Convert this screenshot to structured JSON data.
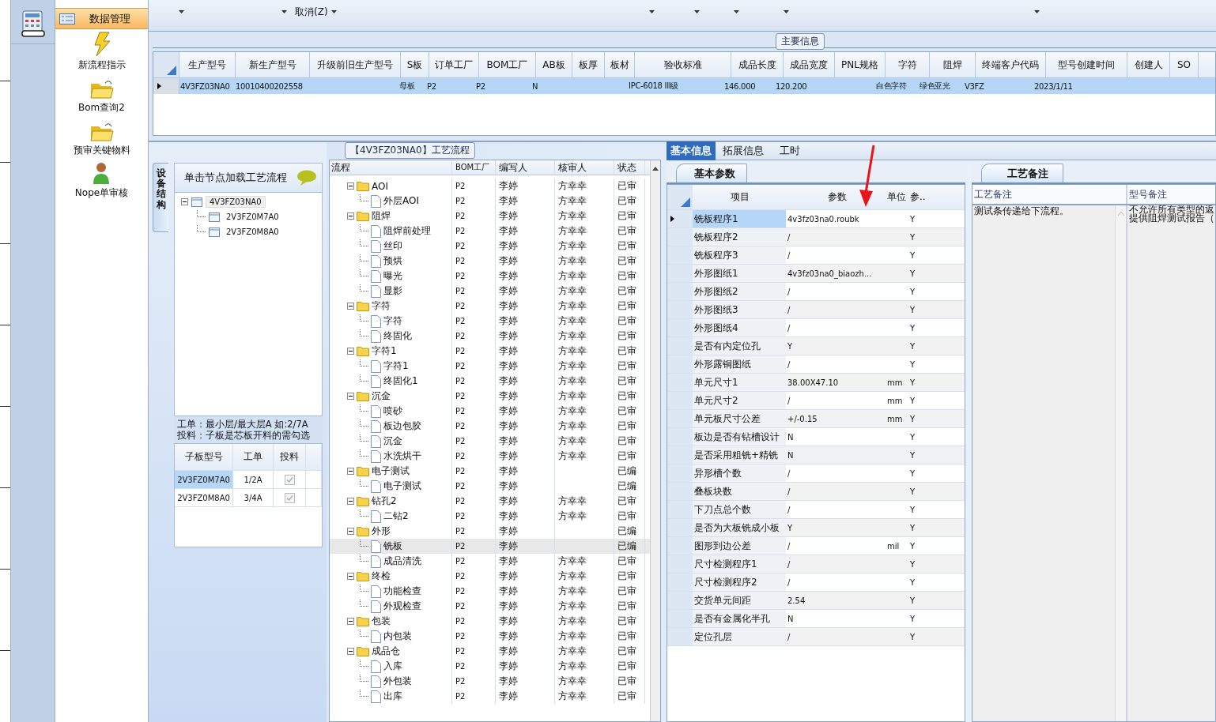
{
  "toolbar": {
    "menu_items": [
      "取消(Z)"
    ]
  },
  "nav": {
    "header": {
      "label": "数据管理",
      "selected": true
    },
    "items": [
      {
        "label": "新流程指示",
        "kind": "lightning"
      },
      {
        "label": "Bom查询2",
        "kind": "folder"
      },
      {
        "label": "预审关键物料",
        "kind": "folder"
      },
      {
        "label": "Nope单审核",
        "kind": "person"
      }
    ]
  },
  "main_info": {
    "title": "主要信息",
    "columns": [
      "生产型号",
      "新生产型号",
      "升级前旧生产型号",
      "S板",
      "订单工厂",
      "BOM工厂",
      "AB板",
      "板厚",
      "板材",
      "验收标准",
      "成品长度",
      "成品宽度",
      "PNL规格",
      "字符",
      "阻焊",
      "终端客户代码",
      "型号创建时间",
      "创建人",
      "SO"
    ],
    "rows": [
      {
        "selected": true,
        "cells": [
          "4V3FZ03NA0",
          "10010400202558",
          "",
          "母板",
          "P2",
          "P2",
          "N",
          "",
          "",
          "IPC-6018 III级",
          "146.000",
          "120.200",
          "",
          "白色字符",
          "绿色亚光",
          "V3FZ",
          "2023/1/11",
          "",
          ""
        ]
      }
    ]
  },
  "structure": {
    "tab_label": "设备结构",
    "hint": "单击节点加载工艺流程",
    "tree": [
      {
        "label": "4V3FZ03NA0",
        "selected": true,
        "expanded": true,
        "children": [
          {
            "label": "2V3FZ0M7A0",
            "selected": false
          },
          {
            "label": "2V3FZ0M8A0",
            "selected": false
          }
        ]
      }
    ],
    "note_lines": [
      "工单：最小层/最大层A 如:2/7A",
      "投料：子板是芯板开料的需勾选"
    ],
    "sub_table": {
      "columns": [
        "子板型号",
        "工单",
        "投料"
      ],
      "rows": [
        {
          "model": "2V3FZ0M7A0",
          "order": "1/2A",
          "feed": true,
          "selected": true
        },
        {
          "model": "2V3FZ0M8A0",
          "order": "3/4A",
          "feed": true,
          "selected": false
        }
      ]
    }
  },
  "flow": {
    "title": "【4V3FZ03NA0】工艺流程",
    "columns": [
      "流程",
      "BOM工厂",
      "编写人",
      "核审人",
      "状态"
    ],
    "tree": [
      {
        "label": "AOI",
        "bom": "P2",
        "writer": "李婷",
        "reviewer": "方幸幸",
        "status": "已审",
        "expanded": true,
        "selected": false,
        "children": [
          {
            "label": "外层AOI",
            "bom": "P2",
            "writer": "李婷",
            "reviewer": "方幸幸",
            "status": "已审",
            "selected": false
          }
        ]
      },
      {
        "label": "阻焊",
        "bom": "P2",
        "writer": "李婷",
        "reviewer": "方幸幸",
        "status": "已审",
        "expanded": true,
        "selected": false,
        "children": [
          {
            "label": "阻焊前处理",
            "bom": "P2",
            "writer": "李婷",
            "reviewer": "方幸幸",
            "status": "已审",
            "selected": false
          },
          {
            "label": "丝印",
            "bom": "P2",
            "writer": "李婷",
            "reviewer": "方幸幸",
            "status": "已审",
            "selected": false
          },
          {
            "label": "预烘",
            "bom": "P2",
            "writer": "李婷",
            "reviewer": "方幸幸",
            "status": "已审",
            "selected": false
          },
          {
            "label": "曝光",
            "bom": "P2",
            "writer": "李婷",
            "reviewer": "方幸幸",
            "status": "已审",
            "selected": false
          },
          {
            "label": "显影",
            "bom": "P2",
            "writer": "李婷",
            "reviewer": "方幸幸",
            "status": "已审",
            "selected": false
          }
        ]
      },
      {
        "label": "字符",
        "bom": "P2",
        "writer": "李婷",
        "reviewer": "方幸幸",
        "status": "已审",
        "expanded": true,
        "selected": false,
        "children": [
          {
            "label": "字符",
            "bom": "P2",
            "writer": "李婷",
            "reviewer": "方幸幸",
            "status": "已审",
            "selected": false
          },
          {
            "label": "终固化",
            "bom": "P2",
            "writer": "李婷",
            "reviewer": "方幸幸",
            "status": "已审",
            "selected": false
          }
        ]
      },
      {
        "label": "字符1",
        "bom": "P2",
        "writer": "李婷",
        "reviewer": "方幸幸",
        "status": "已审",
        "expanded": true,
        "selected": false,
        "children": [
          {
            "label": "字符1",
            "bom": "P2",
            "writer": "李婷",
            "reviewer": "方幸幸",
            "status": "已审",
            "selected": false
          },
          {
            "label": "终固化1",
            "bom": "P2",
            "writer": "李婷",
            "reviewer": "方幸幸",
            "status": "已审",
            "selected": false
          }
        ]
      },
      {
        "label": "沉金",
        "bom": "P2",
        "writer": "李婷",
        "reviewer": "方幸幸",
        "status": "已审",
        "expanded": true,
        "selected": false,
        "children": [
          {
            "label": "喷砂",
            "bom": "P2",
            "writer": "李婷",
            "reviewer": "方幸幸",
            "status": "已审",
            "selected": false
          },
          {
            "label": "板边包胶",
            "bom": "P2",
            "writer": "李婷",
            "reviewer": "方幸幸",
            "status": "已审",
            "selected": false
          },
          {
            "label": "沉金",
            "bom": "P2",
            "writer": "李婷",
            "reviewer": "方幸幸",
            "status": "已审",
            "selected": false
          },
          {
            "label": "水洗烘干",
            "bom": "P2",
            "writer": "李婷",
            "reviewer": "方幸幸",
            "status": "已审",
            "selected": false
          }
        ]
      },
      {
        "label": "电子测试",
        "bom": "P2",
        "writer": "李婷",
        "status": "已编",
        "expanded": true,
        "selected": false,
        "children": [
          {
            "label": "电子测试",
            "bom": "P2",
            "writer": "李婷",
            "status": "已编",
            "selected": false
          }
        ]
      },
      {
        "label": "钻孔2",
        "bom": "P2",
        "writer": "李婷",
        "reviewer": "方幸幸",
        "status": "已审",
        "expanded": true,
        "selected": false,
        "children": [
          {
            "label": "二钻2",
            "bom": "P2",
            "writer": "李婷",
            "reviewer": "方幸幸",
            "status": "已审",
            "selected": false
          }
        ]
      },
      {
        "label": "外形",
        "bom": "P2",
        "writer": "李婷",
        "status": "已编",
        "expanded": true,
        "selected": false,
        "children": [
          {
            "label": "铣板",
            "bom": "P2",
            "writer": "李婷",
            "status": "已编",
            "selected": true
          },
          {
            "label": "成品清洗",
            "bom": "P2",
            "writer": "李婷",
            "reviewer": "方幸幸",
            "status": "已审",
            "selected": false
          }
        ]
      },
      {
        "label": "终检",
        "bom": "P2",
        "writer": "李婷",
        "reviewer": "方幸幸",
        "status": "已审",
        "expanded": true,
        "selected": false,
        "children": [
          {
            "label": "功能检查",
            "bom": "P2",
            "writer": "李婷",
            "reviewer": "方幸幸",
            "status": "已审",
            "selected": false
          },
          {
            "label": "外观检查",
            "bom": "P2",
            "writer": "李婷",
            "reviewer": "方幸幸",
            "status": "已审",
            "selected": false
          }
        ]
      },
      {
        "label": "包装",
        "bom": "P2",
        "writer": "李婷",
        "reviewer": "方幸幸",
        "status": "已审",
        "expanded": true,
        "selected": false,
        "children": [
          {
            "label": "内包装",
            "bom": "P2",
            "writer": "李婷",
            "reviewer": "方幸幸",
            "status": "已审",
            "selected": false
          }
        ]
      },
      {
        "label": "成品仓",
        "bom": "P2",
        "writer": "李婷",
        "reviewer": "方幸幸",
        "status": "已审",
        "expanded": true,
        "selected": false,
        "children": [
          {
            "label": "入库",
            "bom": "P2",
            "writer": "李婷",
            "reviewer": "方幸幸",
            "status": "已审",
            "selected": false
          },
          {
            "label": "外包装",
            "bom": "P2",
            "writer": "李婷",
            "reviewer": "方幸幸",
            "status": "已审",
            "selected": false
          },
          {
            "label": "出库",
            "bom": "P2",
            "writer": "李婷",
            "reviewer": "方幸幸",
            "status": "已审",
            "selected": false
          }
        ]
      }
    ]
  },
  "detail_tabs": [
    {
      "label": "基本信息",
      "selected": true
    },
    {
      "label": "拓展信息",
      "selected": false
    },
    {
      "label": "工时",
      "selected": false
    }
  ],
  "params": {
    "tab": "基本参数",
    "columns": [
      "项目",
      "参数",
      "单位",
      "参.."
    ],
    "rows": [
      {
        "item": "铣板程序1",
        "value": "4v3fz03na0.roubk",
        "unit": "",
        "flag": "Y",
        "selected": true
      },
      {
        "item": "铣板程序2",
        "value": "/",
        "unit": "",
        "flag": "Y",
        "selected": false
      },
      {
        "item": "铣板程序3",
        "value": "/",
        "unit": "",
        "flag": "Y",
        "selected": false
      },
      {
        "item": "外形图纸1",
        "value": "4v3fz03na0_biaozh...",
        "unit": "",
        "flag": "Y",
        "selected": false
      },
      {
        "item": "外形图纸2",
        "value": "/",
        "unit": "",
        "flag": "Y",
        "selected": false
      },
      {
        "item": "外形图纸3",
        "value": "/",
        "unit": "",
        "flag": "Y",
        "selected": false
      },
      {
        "item": "外形图纸4",
        "value": "/",
        "unit": "",
        "flag": "Y",
        "selected": false
      },
      {
        "item": "是否有内定位孔",
        "value": "Y",
        "unit": "",
        "flag": "Y",
        "selected": false
      },
      {
        "item": "外形露铜图纸",
        "value": "/",
        "unit": "",
        "flag": "Y",
        "selected": false
      },
      {
        "item": "单元尺寸1",
        "value": "38.00X47.10",
        "unit": "mm",
        "flag": "Y",
        "selected": false
      },
      {
        "item": "单元尺寸2",
        "value": "/",
        "unit": "mm",
        "flag": "Y",
        "selected": false
      },
      {
        "item": "单元板尺寸公差",
        "value": "+/-0.15",
        "unit": "mm",
        "flag": "Y",
        "selected": false
      },
      {
        "item": "板边是否有钻槽设计",
        "value": "N",
        "unit": "",
        "flag": "Y",
        "selected": false
      },
      {
        "item": "是否采用粗铣+精铣",
        "value": "N",
        "unit": "",
        "flag": "Y",
        "selected": false
      },
      {
        "item": "异形槽个数",
        "value": "/",
        "unit": "",
        "flag": "Y",
        "selected": false
      },
      {
        "item": "叠板块数",
        "value": "/",
        "unit": "",
        "flag": "Y",
        "selected": false
      },
      {
        "item": "下刀点总个数",
        "value": "/",
        "unit": "",
        "flag": "Y",
        "selected": false
      },
      {
        "item": "是否为大板铣成小板",
        "value": "Y",
        "unit": "",
        "flag": "Y",
        "selected": false
      },
      {
        "item": "图形到边公差",
        "value": "/",
        "unit": "mil",
        "flag": "Y",
        "selected": false
      },
      {
        "item": "尺寸检测程序1",
        "value": "/",
        "unit": "",
        "flag": "Y",
        "selected": false
      },
      {
        "item": "尺寸检测程序2",
        "value": "/",
        "unit": "",
        "flag": "Y",
        "selected": false
      },
      {
        "item": "交货单元间距",
        "value": "2.54",
        "unit": "",
        "flag": "Y",
        "selected": false
      },
      {
        "item": "是否有金属化半孔",
        "value": "N",
        "unit": "",
        "flag": "Y",
        "selected": false
      },
      {
        "item": "定位孔层",
        "value": "/",
        "unit": "",
        "flag": "Y",
        "selected": false
      }
    ]
  },
  "notes": {
    "tab": "工艺备注",
    "columns": [
      "工艺备注",
      "型号备注"
    ],
    "process_note": "测试条传递给下流程。",
    "model_note_lines": [
      "不允许所有类型的返",
      "提供阻焊测试报告（"
    ]
  }
}
